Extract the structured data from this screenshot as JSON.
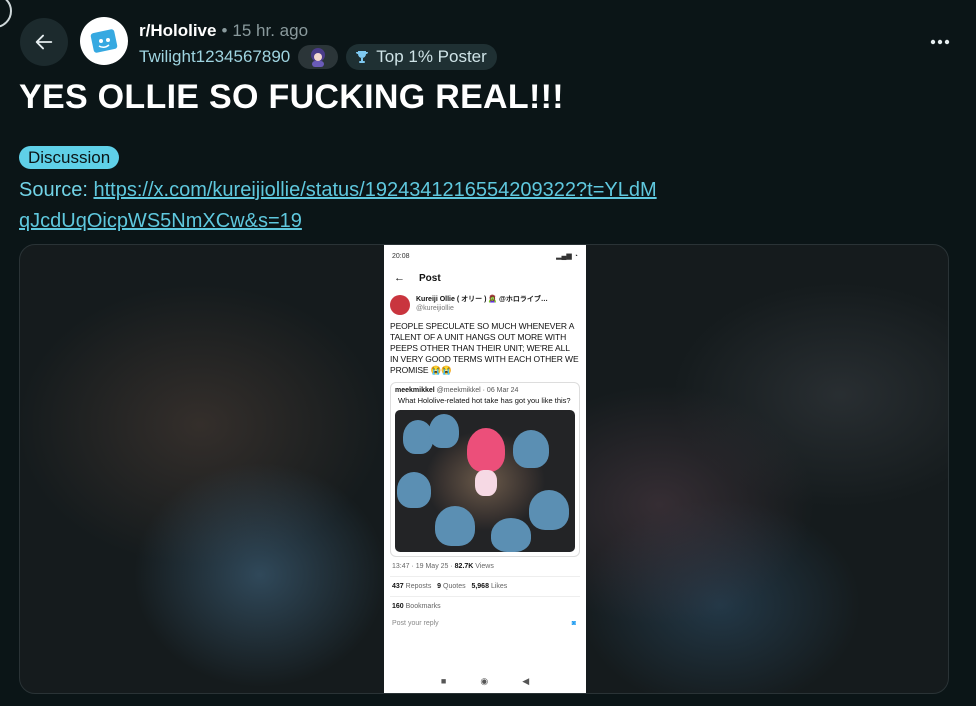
{
  "header": {
    "subreddit": "r/Hololive",
    "separator": "•",
    "time_ago": "15 hr. ago",
    "username": "Twilight1234567890",
    "badge_label": "Top 1% Poster",
    "more_icon": "more-horizontal-icon",
    "back_icon": "arrow-left-icon"
  },
  "post": {
    "title": "YES OLLIE SO FUCKING REAL!!!",
    "flair": "Discussion",
    "source_label": "Source: ",
    "source_url": "https://x.com/kureijiollie/status/1924341216554209322?t=YLdMqJcdUqOicpWS5NmXCw&s=19"
  },
  "screenshot": {
    "status_time": "20:08",
    "header_title": "Post",
    "author_name": "Kureiji Ollie ( オリー ) 🧟‍♀️ @ホロライブ…",
    "author_handle": "@kureijiollie",
    "tweet_text": "PEOPLE SPECULATE SO MUCH WHENEVER A TALENT OF A UNIT HANGS OUT MORE WITH PEEPS OTHER THAN THEIR UNIT; WE'RE ALL IN VERY GOOD TERMS WITH EACH OTHER WE PROMISE 😭😭",
    "quote_author": "meekmikkel",
    "quote_meta": "@meekmikkel · 06 Mar 24",
    "quote_text": "What Hololive-related hot take has got you like this?",
    "tweet_time": "13:47 · 19 May 25 ·",
    "views_count": "82.7K",
    "views_label": "Views",
    "reposts_count": "437",
    "reposts_label": "Reposts",
    "quotes_count": "9",
    "quotes_label": "Quotes",
    "likes_count": "5,968",
    "likes_label": "Likes",
    "bookmarks_count": "160",
    "bookmarks_label": "Bookmarks",
    "reply_placeholder": "Post your reply"
  },
  "colors": {
    "background": "#0b1517",
    "accent": "#5fc8de",
    "flair_bg": "#5fd0e8"
  }
}
